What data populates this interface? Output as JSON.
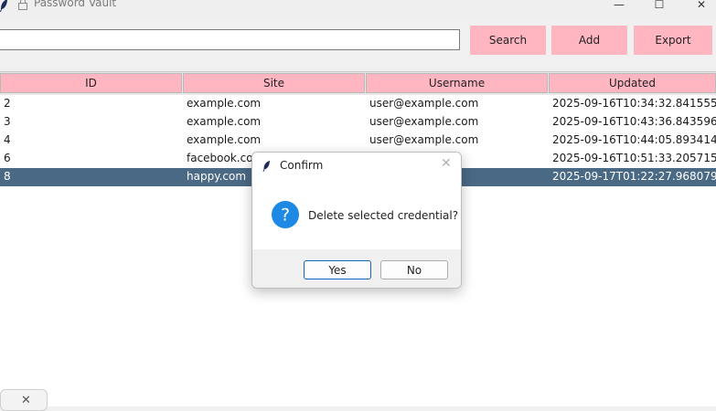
{
  "window": {
    "title": "Password Vault",
    "controls": {
      "minimize": "—",
      "maximize": "☐",
      "close": "✕"
    },
    "icons": {
      "app": "feather-icon",
      "title": "lock-icon"
    }
  },
  "toolbar": {
    "search_value": "",
    "search_label": "Search",
    "add_label": "Add",
    "export_label": "Export",
    "button_color": "#ffb6c1"
  },
  "table": {
    "columns": [
      "ID",
      "Site",
      "Username",
      "Updated"
    ],
    "rows": [
      {
        "id": "2",
        "site": "example.com",
        "username": "user@example.com",
        "updated": "2025-09-16T10:34:32.841555"
      },
      {
        "id": "3",
        "site": "example.com",
        "username": "user@example.com",
        "updated": "2025-09-16T10:43:36.843596"
      },
      {
        "id": "4",
        "site": "example.com",
        "username": "user@example.com",
        "updated": "2025-09-16T10:44:05.893414"
      },
      {
        "id": "6",
        "site": "facebook.com",
        "username": "",
        "updated": "2025-09-16T10:51:33.205715"
      },
      {
        "id": "8",
        "site": "happy.com",
        "username": "",
        "updated": "2025-09-17T01:22:27.968079",
        "selected": true
      }
    ],
    "selected_color": "#4a6984",
    "header_color": "#ffb6c1"
  },
  "dialog": {
    "title": "Confirm",
    "message": "Delete selected credential?",
    "yes_label": "Yes",
    "no_label": "No",
    "close_glyph": "✕",
    "question_glyph": "?",
    "icon": "question-icon",
    "accent": "#1e88e5"
  },
  "toast": {
    "close_glyph": "✕"
  }
}
